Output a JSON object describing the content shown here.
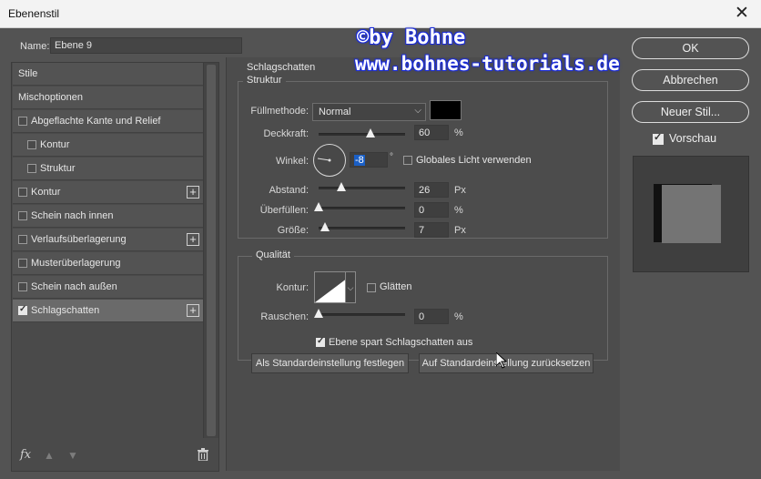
{
  "window": {
    "title": "Ebenenstil",
    "close_glyph": "✕"
  },
  "name_field": {
    "label": "Name:",
    "value": "Ebene 9"
  },
  "watermark": {
    "line1": "©by Bohne",
    "line2": "www.bohnes-tutorials.de"
  },
  "left_list": {
    "items": [
      {
        "label": "Stile",
        "checkbox": false,
        "checked": false,
        "plus": false,
        "indent": 0
      },
      {
        "label": "Mischoptionen",
        "checkbox": false,
        "checked": false,
        "plus": false,
        "indent": 0
      },
      {
        "label": "Abgeflachte Kante und Relief",
        "checkbox": true,
        "checked": false,
        "plus": false,
        "indent": 0
      },
      {
        "label": "Kontur",
        "checkbox": true,
        "checked": false,
        "plus": false,
        "indent": 1
      },
      {
        "label": "Struktur",
        "checkbox": true,
        "checked": false,
        "plus": false,
        "indent": 1
      },
      {
        "label": "Kontur",
        "checkbox": true,
        "checked": false,
        "plus": true,
        "indent": 0
      },
      {
        "label": "Schein nach innen",
        "checkbox": true,
        "checked": false,
        "plus": false,
        "indent": 0
      },
      {
        "label": "Verlaufsüberlagerung",
        "checkbox": true,
        "checked": false,
        "plus": true,
        "indent": 0
      },
      {
        "label": "Musterüberlagerung",
        "checkbox": true,
        "checked": false,
        "plus": false,
        "indent": 0
      },
      {
        "label": "Schein nach außen",
        "checkbox": true,
        "checked": false,
        "plus": false,
        "indent": 0
      },
      {
        "label": "Schlagschatten",
        "checkbox": true,
        "checked": true,
        "plus": true,
        "indent": 0,
        "selected": true
      }
    ],
    "plus_glyph": "+",
    "fx_label": "fx",
    "up_glyph": "▲",
    "down_glyph": "▼"
  },
  "center": {
    "section_title": "Schlagschatten",
    "structure": {
      "legend": "Struktur",
      "blend_mode": {
        "label": "Füllmethode:",
        "value": "Normal",
        "swatch_color": "#000000"
      },
      "opacity": {
        "label": "Deckkraft:",
        "value": "60",
        "unit": "%",
        "fraction": 0.6
      },
      "angle": {
        "label": "Winkel:",
        "value": "-8",
        "degree_glyph": "°",
        "global_light_label": "Globales Licht verwenden",
        "global_light_checked": false
      },
      "distance": {
        "label": "Abstand:",
        "value": "26",
        "unit": "Px",
        "fraction": 0.26
      },
      "spread": {
        "label": "Überfüllen:",
        "value": "0",
        "unit": "%",
        "fraction": 0.0
      },
      "size": {
        "label": "Größe:",
        "value": "7",
        "unit": "Px",
        "fraction": 0.07
      }
    },
    "quality": {
      "legend": "Qualität",
      "contour": {
        "label": "Kontur:",
        "antialias_label": "Glätten",
        "antialias_checked": false
      },
      "noise": {
        "label": "Rauschen:",
        "value": "0",
        "unit": "%",
        "fraction": 0.0
      }
    },
    "knockout": {
      "label": "Ebene spart Schlagschatten aus",
      "checked": true
    },
    "buttons": {
      "set_default": "Als Standardeinstellung festlegen",
      "reset_default": "Auf Standardeinstellung zurücksetzen"
    }
  },
  "right": {
    "ok": "OK",
    "cancel": "Abbrechen",
    "new_style": "Neuer Stil...",
    "preview_label": "Vorschau",
    "preview_checked": true
  },
  "chevron_glyph": "⌵"
}
